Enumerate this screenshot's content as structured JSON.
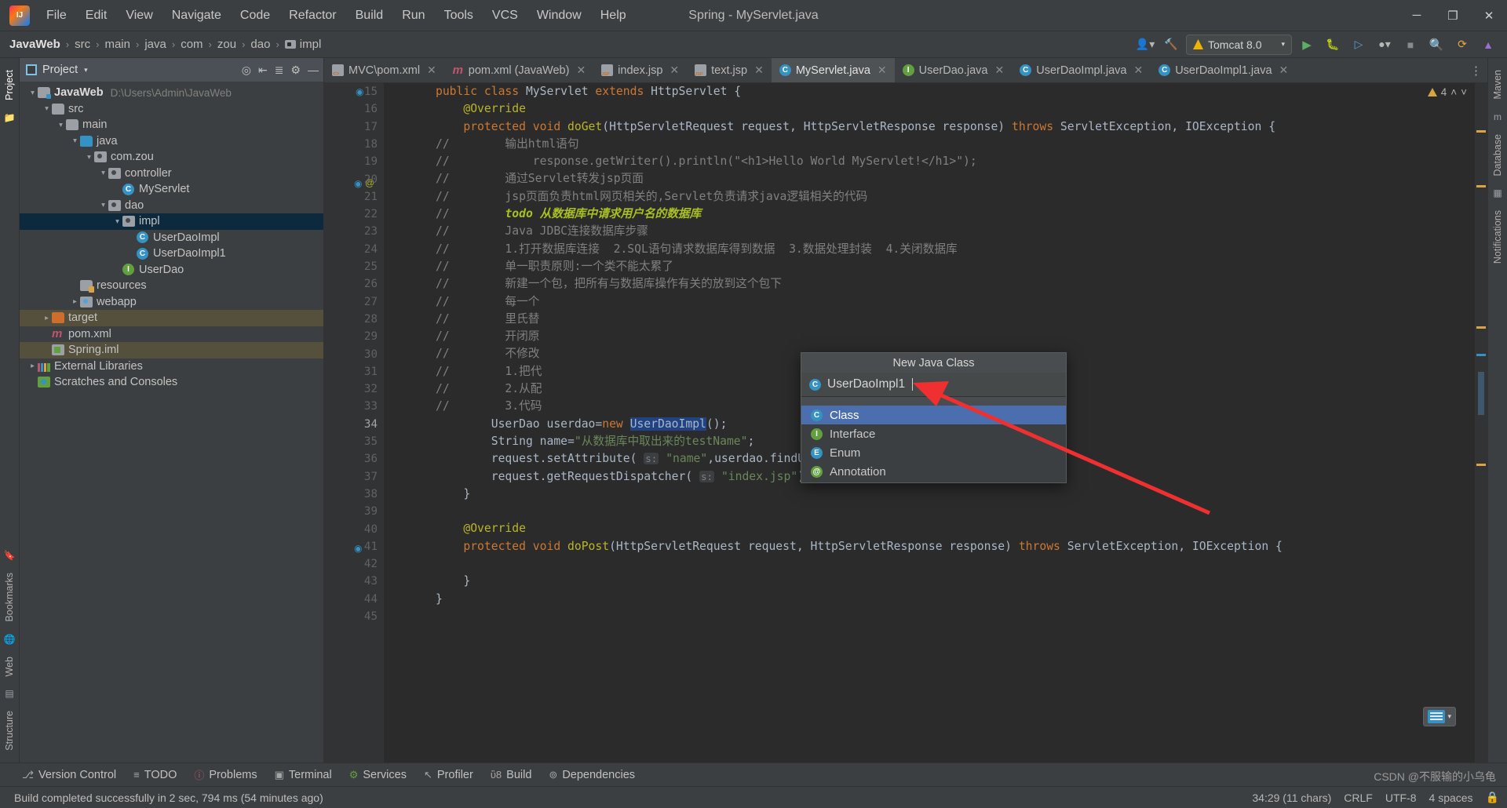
{
  "window": {
    "title": "Spring - MyServlet.java",
    "logo_icon": "intellij-idea-logo",
    "minimize_label": "─",
    "maximize_label": "❐",
    "close_label": "✕"
  },
  "menubar": {
    "items": [
      "File",
      "Edit",
      "View",
      "Navigate",
      "Code",
      "Refactor",
      "Build",
      "Run",
      "Tools",
      "VCS",
      "Window",
      "Help"
    ]
  },
  "breadcrumb": {
    "items": [
      "JavaWeb",
      "src",
      "main",
      "java",
      "com",
      "zou",
      "dao",
      "impl"
    ],
    "separator": "›"
  },
  "toolbar": {
    "user_icon": "user-account-icon",
    "hammer_icon": "build-hammer-icon",
    "run_config": "Tomcat 8.0",
    "run_config_icon": "tomcat-icon",
    "dropdown_caret": "▾",
    "run_icon": "run-play-icon",
    "debug_icon": "debug-bug-icon",
    "run_with_coverage_icon": "run-coverage-icon",
    "profiler_icon": "profiler-icon",
    "stop_icon": "stop-icon",
    "search_icon": "search-icon",
    "updates_icon": "updates-icon",
    "idea_icon": "idea-assistant-icon"
  },
  "left_strip": {
    "tabs": [
      "Project"
    ],
    "bottom_tabs": [
      "Bookmarks",
      "Web",
      "Structure"
    ]
  },
  "right_strip": {
    "tabs": [
      "Maven",
      "Database",
      "Notifications"
    ]
  },
  "project_panel": {
    "title": "Project",
    "caret": "▾",
    "icons": [
      "locate-icon",
      "collapse-all-icon",
      "settings-view-icon",
      "gear-icon",
      "hide-icon"
    ],
    "tree": [
      {
        "label": "JavaWeb",
        "path": "D:\\Users\\Admin\\JavaWeb",
        "depth": 0,
        "arrow": "open",
        "icon": "folder-src",
        "bold": true,
        "state": "normal"
      },
      {
        "label": "src",
        "path": "",
        "depth": 1,
        "arrow": "open",
        "icon": "folder",
        "bold": false,
        "state": "normal"
      },
      {
        "label": "main",
        "path": "",
        "depth": 2,
        "arrow": "open",
        "icon": "folder",
        "bold": false,
        "state": "normal"
      },
      {
        "label": "java",
        "path": "",
        "depth": 3,
        "arrow": "open",
        "icon": "folder-blue",
        "bold": false,
        "state": "normal"
      },
      {
        "label": "com.zou",
        "path": "",
        "depth": 4,
        "arrow": "open",
        "icon": "package",
        "bold": false,
        "state": "normal"
      },
      {
        "label": "controller",
        "path": "",
        "depth": 5,
        "arrow": "open",
        "icon": "package",
        "bold": false,
        "state": "normal"
      },
      {
        "label": "MyServlet",
        "path": "",
        "depth": 6,
        "arrow": "none",
        "icon": "class",
        "bold": false,
        "state": "normal"
      },
      {
        "label": "dao",
        "path": "",
        "depth": 5,
        "arrow": "open",
        "icon": "package",
        "bold": false,
        "state": "normal"
      },
      {
        "label": "impl",
        "path": "",
        "depth": 6,
        "arrow": "open",
        "icon": "package",
        "bold": false,
        "state": "selected"
      },
      {
        "label": "UserDaoImpl",
        "path": "",
        "depth": 7,
        "arrow": "none",
        "icon": "class",
        "bold": false,
        "state": "normal"
      },
      {
        "label": "UserDaoImpl1",
        "path": "",
        "depth": 7,
        "arrow": "none",
        "icon": "class",
        "bold": false,
        "state": "normal"
      },
      {
        "label": "UserDao",
        "path": "",
        "depth": 6,
        "arrow": "none",
        "icon": "interface",
        "bold": false,
        "state": "normal"
      },
      {
        "label": "resources",
        "path": "",
        "depth": 3,
        "arrow": "none",
        "icon": "folder-resources",
        "bold": false,
        "state": "normal"
      },
      {
        "label": "webapp",
        "path": "",
        "depth": 3,
        "arrow": "closed",
        "icon": "webapp",
        "bold": false,
        "state": "normal"
      },
      {
        "label": "target",
        "path": "",
        "depth": 1,
        "arrow": "closed",
        "icon": "folder-orange",
        "bold": false,
        "state": "highlight"
      },
      {
        "label": "pom.xml",
        "path": "",
        "depth": 1,
        "arrow": "none",
        "icon": "maven",
        "bold": false,
        "state": "normal"
      },
      {
        "label": "Spring.iml",
        "path": "",
        "depth": 1,
        "arrow": "none",
        "icon": "iml",
        "bold": false,
        "state": "highlight"
      },
      {
        "label": "External Libraries",
        "path": "",
        "depth": 0,
        "arrow": "closed",
        "icon": "libraries",
        "bold": false,
        "state": "normal"
      },
      {
        "label": "Scratches and Consoles",
        "path": "",
        "depth": 0,
        "arrow": "none",
        "icon": "scratch",
        "bold": false,
        "state": "normal"
      }
    ]
  },
  "editor_tabs": [
    {
      "label": "MVC\\pom.xml",
      "icon": "xml-file-icon",
      "active": false,
      "close": "✕"
    },
    {
      "label": "pom.xml (JavaWeb)",
      "icon": "maven-file-icon",
      "active": false,
      "close": "✕"
    },
    {
      "label": "index.jsp",
      "icon": "jsp-file-icon",
      "active": false,
      "close": "✕"
    },
    {
      "label": "text.jsp",
      "icon": "jsp-file-icon",
      "active": false,
      "close": "✕"
    },
    {
      "label": "MyServlet.java",
      "icon": "java-class-icon",
      "active": true,
      "close": "✕"
    },
    {
      "label": "UserDao.java",
      "icon": "java-interface-icon",
      "active": false,
      "close": "✕"
    },
    {
      "label": "UserDaoImpl.java",
      "icon": "java-class-icon",
      "active": false,
      "close": "✕"
    },
    {
      "label": "UserDaoImpl1.java",
      "icon": "java-class-icon",
      "active": false,
      "close": "✕"
    }
  ],
  "editor": {
    "more_tabs_icon": "more-tabs-icon",
    "warning_count": "4",
    "warning_icon": "warning-triangle-icon",
    "inspection_up_icon": "˄",
    "inspection_down_icon": "˅",
    "first_line_number": 15,
    "lines": [
      {
        "n": 15,
        "html": "<span class=\"kw\">public class </span><span class=\"typ\">MyServlet </span><span class=\"kw\">extends </span><span class=\"typ\">HttpServlet </span>{"
      },
      {
        "n": 16,
        "html": "    <span class=\"ann\">@Override</span>"
      },
      {
        "n": 17,
        "html": "    <span class=\"kw\">protected void </span><span class=\"ann\">doGet</span>(<span class=\"typ\">HttpServletRequest </span>request, <span class=\"typ\">HttpServletResponse </span>response) <span class=\"kw\">throws </span><span class=\"typ\">ServletException</span>, <span class=\"typ\">IOException </span>{"
      },
      {
        "n": 18,
        "html": "<span class=\"cmt\">//        输出html语句</span>"
      },
      {
        "n": 19,
        "html": "<span class=\"cmt\">//            response.getWriter().println(\"&lt;h1&gt;Hello World MyServlet!&lt;/h1&gt;\");</span>"
      },
      {
        "n": 20,
        "html": "<span class=\"cmt\">//        通过Servlet转发jsp页面</span>"
      },
      {
        "n": 21,
        "html": "<span class=\"cmt\">//        jsp页面负责html网页相关的,Servlet负责请求java逻辑相关的代码</span>"
      },
      {
        "n": 22,
        "html": "<span class=\"cmt\">//        </span><span class=\"todo\">todo 从数据库中请求用户名的数据库</span>"
      },
      {
        "n": 23,
        "html": "<span class=\"cmt\">//        Java JDBC连接数据库步骤</span>"
      },
      {
        "n": 24,
        "html": "<span class=\"cmt\">//        1.打开数据库连接  2.SQL语句请求数据库得到数据  3.数据处理封装  4.关闭数据库</span>"
      },
      {
        "n": 25,
        "html": "<span class=\"cmt\">//        单一职责原则:一个类不能太累了</span>"
      },
      {
        "n": 26,
        "html": "<span class=\"cmt\">//        新建一个包，把所有与数据库操作有关的放到这个包下</span>"
      },
      {
        "n": 27,
        "html": "<span class=\"cmt\">//        每一个</span>"
      },
      {
        "n": 28,
        "html": "<span class=\"cmt\">//        里氏替</span>"
      },
      {
        "n": 29,
        "html": "<span class=\"cmt\">//        开闭原</span>"
      },
      {
        "n": 30,
        "html": "<span class=\"cmt\">//        不修改</span>"
      },
      {
        "n": 31,
        "html": "<span class=\"cmt\">//        1.把代</span>"
      },
      {
        "n": 32,
        "html": "<span class=\"cmt\">//        2.从配</span>"
      },
      {
        "n": 33,
        "html": "<span class=\"cmt\">//        3.代码</span>"
      },
      {
        "n": 34,
        "html": "        <span class=\"typ\">UserDao </span>userdao=<span class=\"kw\">new </span><span class=\"hl-sel\">UserDaoImpl</span>();"
      },
      {
        "n": 35,
        "html": "        <span class=\"typ\">String </span>name=<span class=\"str\">\"从数据库中取出来的testName\"</span>;"
      },
      {
        "n": 36,
        "html": "        request.setAttribute( <span class=\"hint\">s:</span> <span class=\"str\">\"name\"</span>,userdao.findUser());"
      },
      {
        "n": 37,
        "html": "        request.getRequestDispatcher( <span class=\"hint\">s:</span> <span class=\"str\">\"index.jsp\"</span>).forward(request,response);"
      },
      {
        "n": 38,
        "html": "    }"
      },
      {
        "n": 39,
        "html": ""
      },
      {
        "n": 40,
        "html": "    <span class=\"ann\">@Override</span>"
      },
      {
        "n": 41,
        "html": "    <span class=\"kw\">protected void </span><span class=\"ann\">doPost</span>(<span class=\"typ\">HttpServletRequest </span>request, <span class=\"typ\">HttpServletResponse </span>response) <span class=\"kw\">throws </span><span class=\"typ\">ServletException</span>, <span class=\"typ\">IOException </span>{"
      },
      {
        "n": 42,
        "html": ""
      },
      {
        "n": 43,
        "html": "    }"
      },
      {
        "n": 44,
        "html": "}"
      },
      {
        "n": 45,
        "html": ""
      }
    ]
  },
  "popup": {
    "title": "New Java Class",
    "input_value": "UserDaoImpl1",
    "input_icon": "java-class-icon",
    "items": [
      {
        "label": "Class",
        "icon": "class-icon",
        "selected": true
      },
      {
        "label": "Interface",
        "icon": "interface-icon",
        "selected": false
      },
      {
        "label": "Enum",
        "icon": "enum-icon",
        "selected": false
      },
      {
        "label": "Annotation",
        "icon": "annotation-icon",
        "selected": false
      }
    ]
  },
  "bottom_bar": {
    "items": [
      {
        "label": "Version Control",
        "icon": "version-control-icon"
      },
      {
        "label": "TODO",
        "icon": "todo-list-icon"
      },
      {
        "label": "Problems",
        "icon": "problems-icon"
      },
      {
        "label": "Terminal",
        "icon": "terminal-icon"
      },
      {
        "label": "Services",
        "icon": "services-icon"
      },
      {
        "label": "Profiler",
        "icon": "profiler-icon"
      },
      {
        "label": "Build",
        "icon": "build-hammer-icon"
      },
      {
        "label": "Dependencies",
        "icon": "dependencies-icon"
      }
    ]
  },
  "status_bar": {
    "message": "Build completed successfully in 2 sec, 794 ms (54 minutes ago)",
    "caret_position": "34:29 (11 chars)",
    "line_separator": "CRLF",
    "encoding": "UTF-8",
    "indent": "4 spaces",
    "lock_icon": "lock-icon",
    "watermark": "CSDN @不服输的小乌龟"
  },
  "float_widget": {
    "icon": "screenshot-widget-icon",
    "caret": "▾"
  },
  "colors": {
    "accent_blue": "#4b6eaf",
    "selection_blue": "#214283",
    "tree_selection": "#0d293e",
    "highlight_olive": "#54503c",
    "bg_editor": "#2b2b2b",
    "bg_panel": "#3c3f41",
    "arrow_red": "#f03030"
  }
}
